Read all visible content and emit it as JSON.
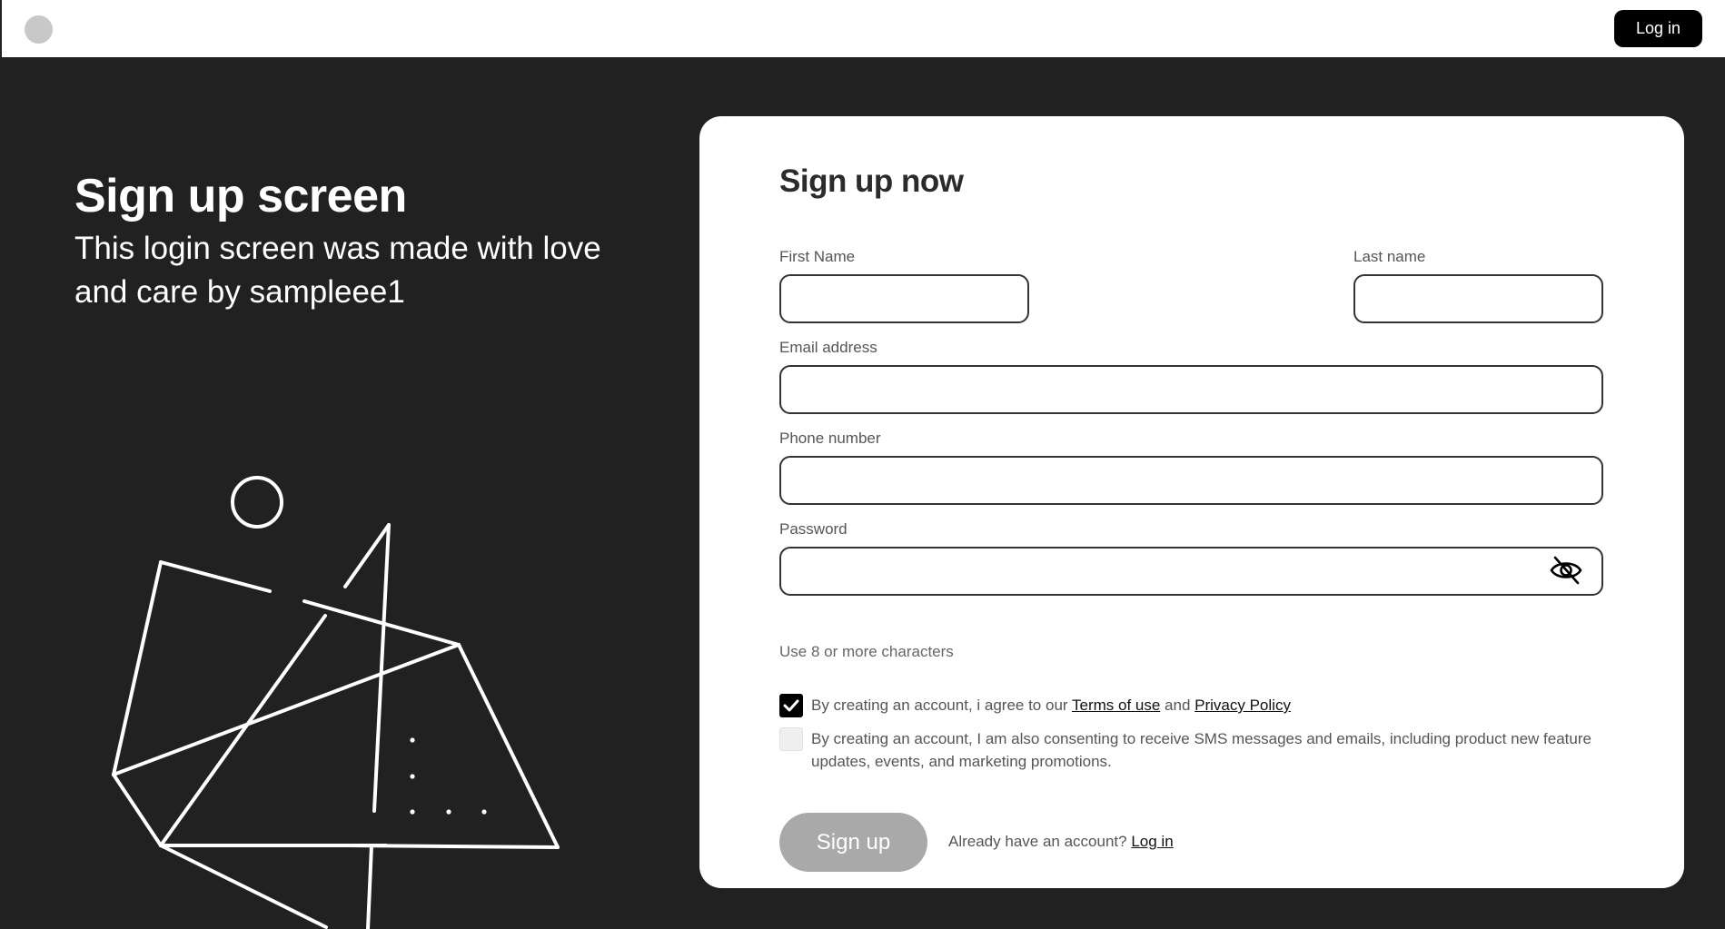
{
  "topbar": {
    "login_label": "Log in"
  },
  "hero": {
    "title": "Sign up screen",
    "subtitle": "This login screen was made with love and care by sampleee1"
  },
  "form": {
    "title": "Sign up now",
    "first_name": {
      "label": "First Name",
      "value": ""
    },
    "last_name": {
      "label": "Last name",
      "value": ""
    },
    "email": {
      "label": "Email address",
      "value": ""
    },
    "phone": {
      "label": "Phone number",
      "value": ""
    },
    "password": {
      "label": "Password",
      "value": "",
      "toggle_icon": "eye-slash-icon"
    },
    "password_hint": "Use 8 or more characters",
    "terms": {
      "checked": true,
      "prefix": "By creating an account, i agree to our",
      "terms_link": "Terms of use",
      "and": "and",
      "privacy_link": "Privacy Policy"
    },
    "marketing": {
      "checked": false,
      "text": "By creating an account, I am also consenting to receive SMS messages and emails, including product new feature updates, events, and marketing promotions."
    },
    "submit_label": "Sign up",
    "switch_prompt": "Already have an account?",
    "switch_link": "Log in"
  },
  "colors": {
    "background": "#212121",
    "card": "#ffffff",
    "accent": "#000000",
    "button_disabled": "#a9a9a9"
  }
}
